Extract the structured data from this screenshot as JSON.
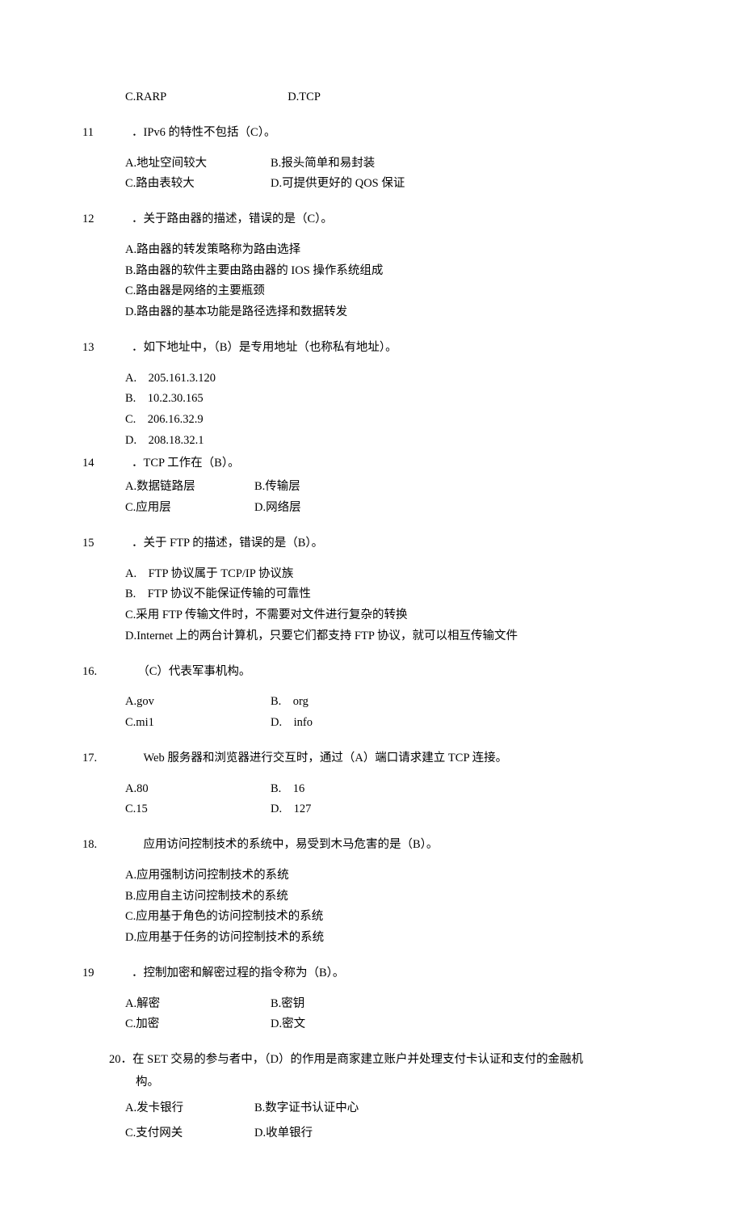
{
  "q10": {
    "optC": "C.RARP",
    "optD": "D.TCP"
  },
  "q11": {
    "num": "11",
    "stem": "．IPv6 的特性不包括（C）。",
    "optA": "A.地址空间较大",
    "optB": "B.报头简单和易封装",
    "optC": "C.路由表较大",
    "optD": "D.可提供更好的 QOS 保证"
  },
  "q12": {
    "num": "12",
    "stem": "．关于路由器的描述，错误的是（C）。",
    "optA": "A.路由器的转发策略称为路由选择",
    "optB": "B.路由器的软件主要由路由器的 IOS 操作系统组成",
    "optC": "C.路由器是网络的主要瓶颈",
    "optD": "D.路由器的基本功能是路径选择和数据转发"
  },
  "q13": {
    "num": "13",
    "stem": "．如下地址中，（B）是专用地址（也称私有地址）。",
    "optA": "A.　205.161.3.120",
    "optB": "B.　10.2.30.165",
    "optC": "C.　206.16.32.9",
    "optD": "D.　208.18.32.1"
  },
  "q14": {
    "num": "14",
    "stem": "．TCP 工作在（B）。",
    "optA": "A.数据链路层",
    "optB": "B.传输层",
    "optC": "C.应用层",
    "optD": "D.网络层"
  },
  "q15": {
    "num": "15",
    "stem": "．关于 FTP 的描述，错误的是（B）。",
    "optA": "A.　FTP 协议属于 TCP/IP 协议族",
    "optB": "B.　FTP 协议不能保证传输的可靠性",
    "optC": "C.采用 FTP 传输文件时，不需要对文件进行复杂的转换",
    "optD": "D.Internet 上的两台计算机，只要它们都支持 FTP 协议，就可以相互传输文件"
  },
  "q16": {
    "num": "16.",
    "stem": "（C）代表军事机构。",
    "optA": "A.gov",
    "optB": "B.　org",
    "optC": "C.mi1",
    "optD": "D.　info"
  },
  "q17": {
    "num": "17.",
    "stem": "　Web 服务器和浏览器进行交互时，通过（A）端口请求建立 TCP 连接。",
    "optA": "A.80",
    "optB": "B.　16",
    "optC": "C.15",
    "optD": "D.　127"
  },
  "q18": {
    "num": "18.",
    "stem": "　应用访问控制技术的系统中，易受到木马危害的是（B）。",
    "optA": "A.应用强制访问控制技术的系统",
    "optB": "B.应用自主访问控制技术的系统",
    "optC": "C.应用基于角色的访问控制技术的系统",
    "optD": "D.应用基于任务的访问控制技术的系统"
  },
  "q19": {
    "num": "19",
    "stem": "．控制加密和解密过程的指令称为（B）。",
    "optA": "A.解密",
    "optB": "B.密钥",
    "optC": "C.加密",
    "optD": "D.密文"
  },
  "q20": {
    "num": "20",
    "stem_line1": "．在 SET 交易的参与者中，（D）的作用是商家建立账户并处理支付卡认证和支付的金融机",
    "stem_line2": "构。",
    "optA": "A.发卡银行",
    "optB": "B.数字证书认证中心",
    "optC": "C.支付网关",
    "optD": "D.收单银行"
  }
}
